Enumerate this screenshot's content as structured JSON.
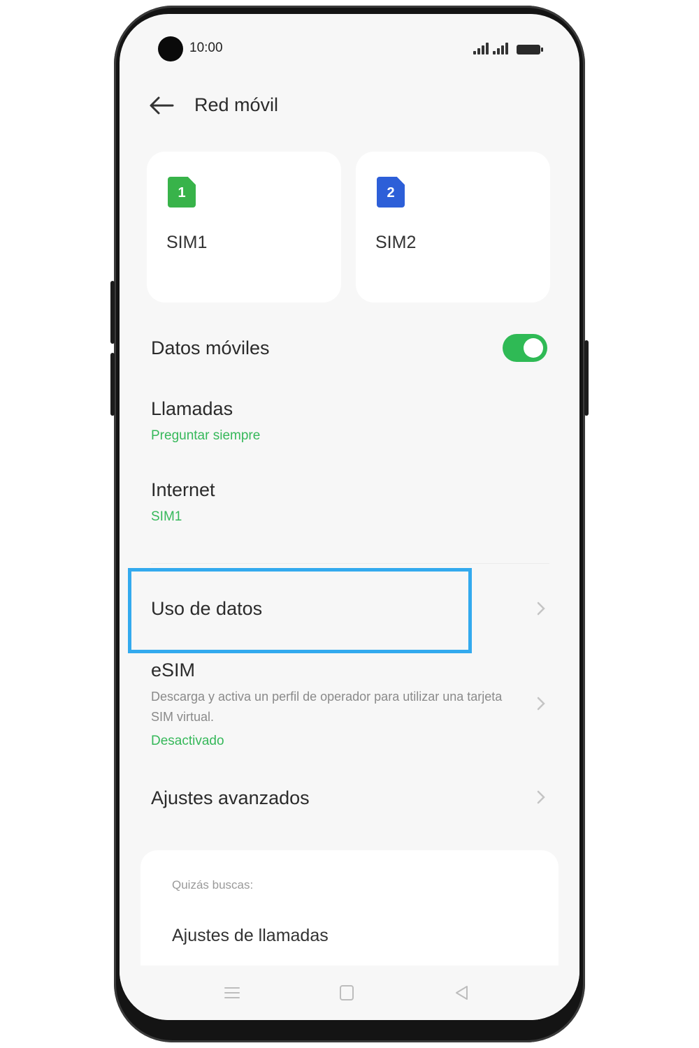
{
  "status_bar": {
    "time": "10:00"
  },
  "header": {
    "title": "Red móvil"
  },
  "sims": [
    {
      "number": "1",
      "label": "SIM1",
      "color": "#38b34a"
    },
    {
      "number": "2",
      "label": "SIM2",
      "color": "#2d5fd8"
    }
  ],
  "mobile_data": {
    "label": "Datos móviles",
    "enabled": true
  },
  "calls": {
    "label": "Llamadas",
    "value": "Preguntar siempre"
  },
  "internet": {
    "label": "Internet",
    "value": "SIM1"
  },
  "data_usage": {
    "label": "Uso de datos"
  },
  "esim": {
    "label": "eSIM",
    "description": "Descarga y activa un perfil de operador para utilizar una tarjeta SIM virtual.",
    "status": "Desactivado"
  },
  "advanced": {
    "label": "Ajustes avanzados"
  },
  "suggestions": {
    "heading": "Quizás buscas:",
    "items": [
      "Ajustes de llamadas"
    ]
  },
  "colors": {
    "accent_green": "#36b85a",
    "highlight_blue": "#33aaee"
  }
}
